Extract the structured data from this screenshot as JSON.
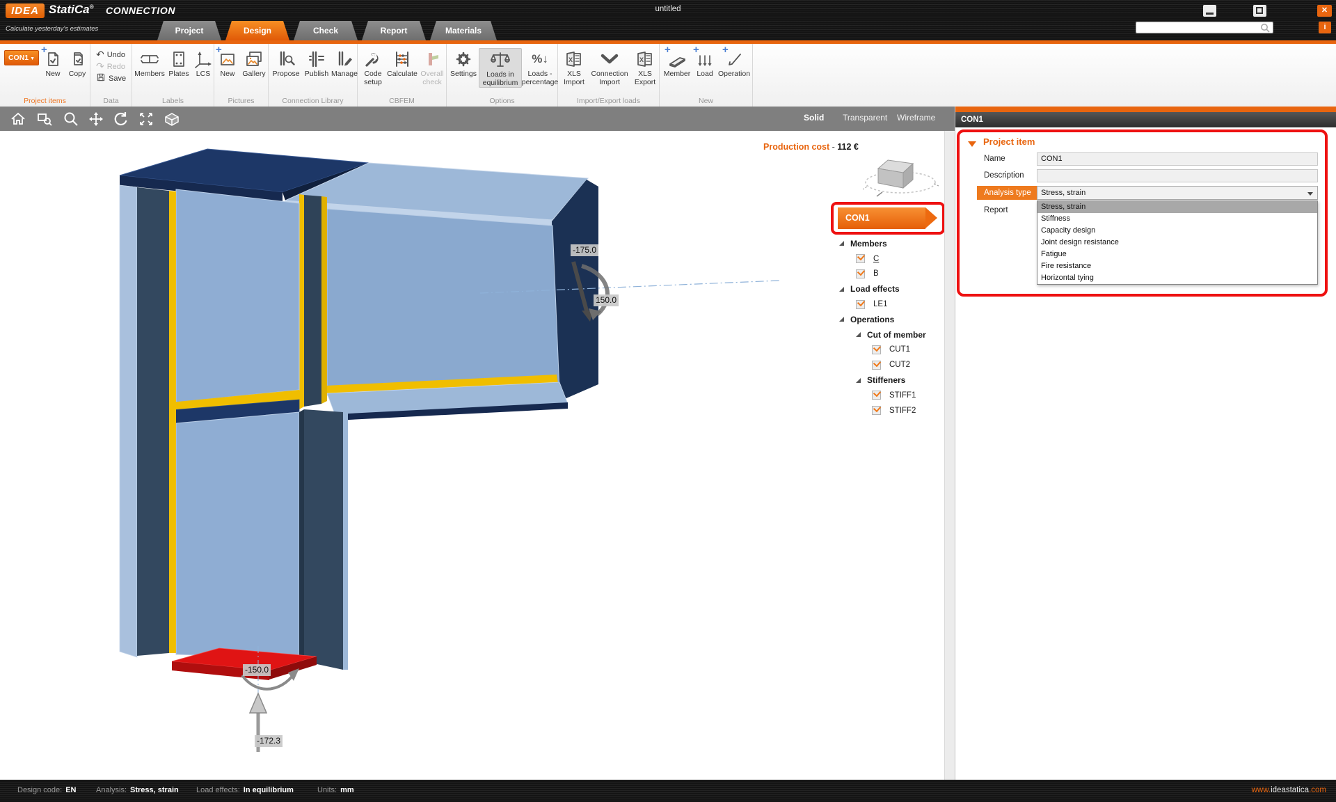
{
  "title_bar": {
    "logo_idea": "IDEA",
    "logo_statica": "StatiCa",
    "logo_reg": "®",
    "app_name": "CONNECTION",
    "tagline": "Calculate yesterday's estimates",
    "document_title": "untitled",
    "close_glyph": "✕",
    "info_glyph": "i"
  },
  "tabs": [
    {
      "label": "Project"
    },
    {
      "label": "Design"
    },
    {
      "label": "Check"
    },
    {
      "label": "Report"
    },
    {
      "label": "Materials"
    }
  ],
  "active_tab": "Design",
  "ribbon": {
    "groups": [
      {
        "name": "Project items",
        "con1_button": "CON1",
        "items": [
          {
            "label": "New"
          },
          {
            "label": "Copy"
          }
        ]
      },
      {
        "name": "Data",
        "items": [
          {
            "label": "Undo"
          },
          {
            "label": "Redo"
          },
          {
            "label": "Save"
          }
        ]
      },
      {
        "name": "Labels",
        "items": [
          {
            "label": "Members"
          },
          {
            "label": "Plates"
          },
          {
            "label": "LCS"
          }
        ]
      },
      {
        "name": "Pictures",
        "items": [
          {
            "label": "New"
          },
          {
            "label": "Gallery"
          }
        ]
      },
      {
        "name": "Connection Library",
        "items": [
          {
            "label": "Propose"
          },
          {
            "label": "Publish"
          },
          {
            "label": "Manage"
          }
        ]
      },
      {
        "name": "CBFEM",
        "items": [
          {
            "label": "Code setup"
          },
          {
            "label": "Calculate"
          },
          {
            "label": "Overall check"
          }
        ]
      },
      {
        "name": "Options",
        "items": [
          {
            "label": "Settings"
          },
          {
            "label": "Loads in equilibrium"
          },
          {
            "label": "Loads - percentage"
          }
        ]
      },
      {
        "name": "Import/Export loads",
        "items": [
          {
            "label": "XLS Import"
          },
          {
            "label": "Connection Import"
          },
          {
            "label": "XLS Export"
          }
        ]
      },
      {
        "name": "New",
        "items": [
          {
            "label": "Member"
          },
          {
            "label": "Load"
          },
          {
            "label": "Operation"
          }
        ]
      }
    ],
    "undo_glyph": "↶",
    "redo_glyph": "↷",
    "percent_glyph": "%",
    "arrow_down_glyph": "↓",
    "pencil_glyph": "✎",
    "xls_glyph": "X"
  },
  "viewport_toolbar": {
    "modes": [
      {
        "label": "Solid"
      },
      {
        "label": "Transparent"
      },
      {
        "label": "Wireframe"
      }
    ],
    "active_mode": "Solid"
  },
  "viewport": {
    "production_cost_label": "Production cost",
    "production_cost_separator": "-",
    "production_cost_value": "112 €",
    "load_labels": {
      "moment_top": "-175.0",
      "shear_top": "150.0",
      "moment_bottom": "-150.0",
      "force_bottom": "-172.3"
    }
  },
  "tree": {
    "banner": "CON1",
    "rows": [
      {
        "label": "Members",
        "type": "group",
        "level": 1
      },
      {
        "label": "C",
        "type": "item",
        "level": 2,
        "checked": true
      },
      {
        "label": "B",
        "type": "item",
        "level": 2,
        "checked": true
      },
      {
        "label": "Load effects",
        "type": "group",
        "level": 1
      },
      {
        "label": "LE1",
        "type": "item",
        "level": 2,
        "checked": true
      },
      {
        "label": "Operations",
        "type": "group",
        "level": 1
      },
      {
        "label": "Cut of member",
        "type": "group",
        "level": 2
      },
      {
        "label": "CUT1",
        "type": "item",
        "level": 3,
        "checked": true
      },
      {
        "label": "CUT2",
        "type": "item",
        "level": 3,
        "checked": true
      },
      {
        "label": "Stiffeners",
        "type": "group",
        "level": 2
      },
      {
        "label": "STIFF1",
        "type": "item",
        "level": 3,
        "checked": true
      },
      {
        "label": "STIFF2",
        "type": "item",
        "level": 3,
        "checked": true
      }
    ]
  },
  "properties_panel": {
    "header": "CON1",
    "section_title": "Project item",
    "fields": {
      "name_label": "Name",
      "name_value": "CON1",
      "description_label": "Description",
      "description_value": "",
      "analysis_type_label": "Analysis type",
      "analysis_type_value": "Stress, strain",
      "report_label": "Report"
    },
    "analysis_type_options": [
      {
        "label": "Stress, strain",
        "selected": true
      },
      {
        "label": "Stiffness"
      },
      {
        "label": "Capacity design"
      },
      {
        "label": "Joint design resistance"
      },
      {
        "label": "Fatigue"
      },
      {
        "label": "Fire resistance"
      },
      {
        "label": "Horizontal tying"
      }
    ]
  },
  "status_bar": {
    "items": [
      {
        "label": "Design code:",
        "value": "EN"
      },
      {
        "label": "Analysis:",
        "value": "Stress, strain"
      },
      {
        "label": "Load effects:",
        "value": "In equilibrium"
      },
      {
        "label": "Units:",
        "value": "mm"
      }
    ],
    "website": {
      "prefix": "www.",
      "domain": "ideastatica",
      "suffix": ".com"
    }
  },
  "colors": {
    "accent_orange": "#e8650f",
    "highlight_red": "#ee1111",
    "weld_yellow": "#f0be00",
    "steel_blue": "#8aa9cf",
    "steel_navy": "#1d3767",
    "plate_red": "#dd1111"
  }
}
